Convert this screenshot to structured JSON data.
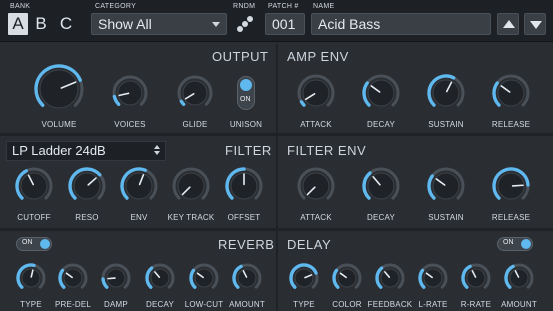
{
  "header": {
    "bank_label": "BANK",
    "banks": [
      "A",
      "B",
      "C"
    ],
    "active_bank": "A",
    "category_label": "CATEGORY",
    "category_value": "Show All",
    "rndm_label": "RNDM",
    "patch_label": "PATCH #",
    "patch_value": "001",
    "name_label": "NAME",
    "name_value": "Acid Bass"
  },
  "output": {
    "title": "OUTPUT",
    "knobs": [
      {
        "label": "VOLUME",
        "value": 0.75
      },
      {
        "label": "VOICES",
        "value": 0.12
      },
      {
        "label": "GLIDE",
        "value": 0.05
      }
    ],
    "unison": {
      "label": "UNISON",
      "state": "ON"
    }
  },
  "amp_env": {
    "title": "AMP ENV",
    "knobs": [
      {
        "label": "ATTACK",
        "value": 0.05
      },
      {
        "label": "DECAY",
        "value": 0.3
      },
      {
        "label": "SUSTAIN",
        "value": 0.6
      },
      {
        "label": "RELEASE",
        "value": 0.3
      }
    ]
  },
  "filter": {
    "title": "FILTER",
    "type_value": "LP Ladder 24dB",
    "knobs": [
      {
        "label": "CUTOFF",
        "value": 0.4
      },
      {
        "label": "RESO",
        "value": 0.68
      },
      {
        "label": "ENV",
        "value": 0.58
      },
      {
        "label": "KEY TRACK",
        "value": 0.0
      },
      {
        "label": "OFFSET",
        "value": 0.5
      }
    ]
  },
  "filter_env": {
    "title": "FILTER ENV",
    "knobs": [
      {
        "label": "ATTACK",
        "value": 0.0
      },
      {
        "label": "DECAY",
        "value": 0.35
      },
      {
        "label": "SUSTAIN",
        "value": 0.3
      },
      {
        "label": "RELEASE",
        "value": 0.82
      }
    ]
  },
  "reverb": {
    "title": "REVERB",
    "toggle": "ON",
    "knobs": [
      {
        "label": "TYPE",
        "value": 0.55
      },
      {
        "label": "PRE-DEL",
        "value": 0.3
      },
      {
        "label": "DAMP",
        "value": 0.15
      },
      {
        "label": "DECAY",
        "value": 0.35
      },
      {
        "label": "LOW-CUT",
        "value": 0.3
      },
      {
        "label": "AMOUNT",
        "value": 0.4
      }
    ]
  },
  "delay": {
    "title": "DELAY",
    "toggle": "ON",
    "knobs": [
      {
        "label": "TYPE",
        "value": 0.75
      },
      {
        "label": "COLOR",
        "value": 0.3
      },
      {
        "label": "FEEDBACK",
        "value": 0.35
      },
      {
        "label": "L-RATE",
        "value": 0.3
      },
      {
        "label": "R-RATE",
        "value": 0.4
      },
      {
        "label": "AMOUNT",
        "value": 0.4
      }
    ]
  },
  "colors": {
    "accent": "#5fb8ee",
    "background": "#2a2e33",
    "header_bg": "#1d2024"
  }
}
